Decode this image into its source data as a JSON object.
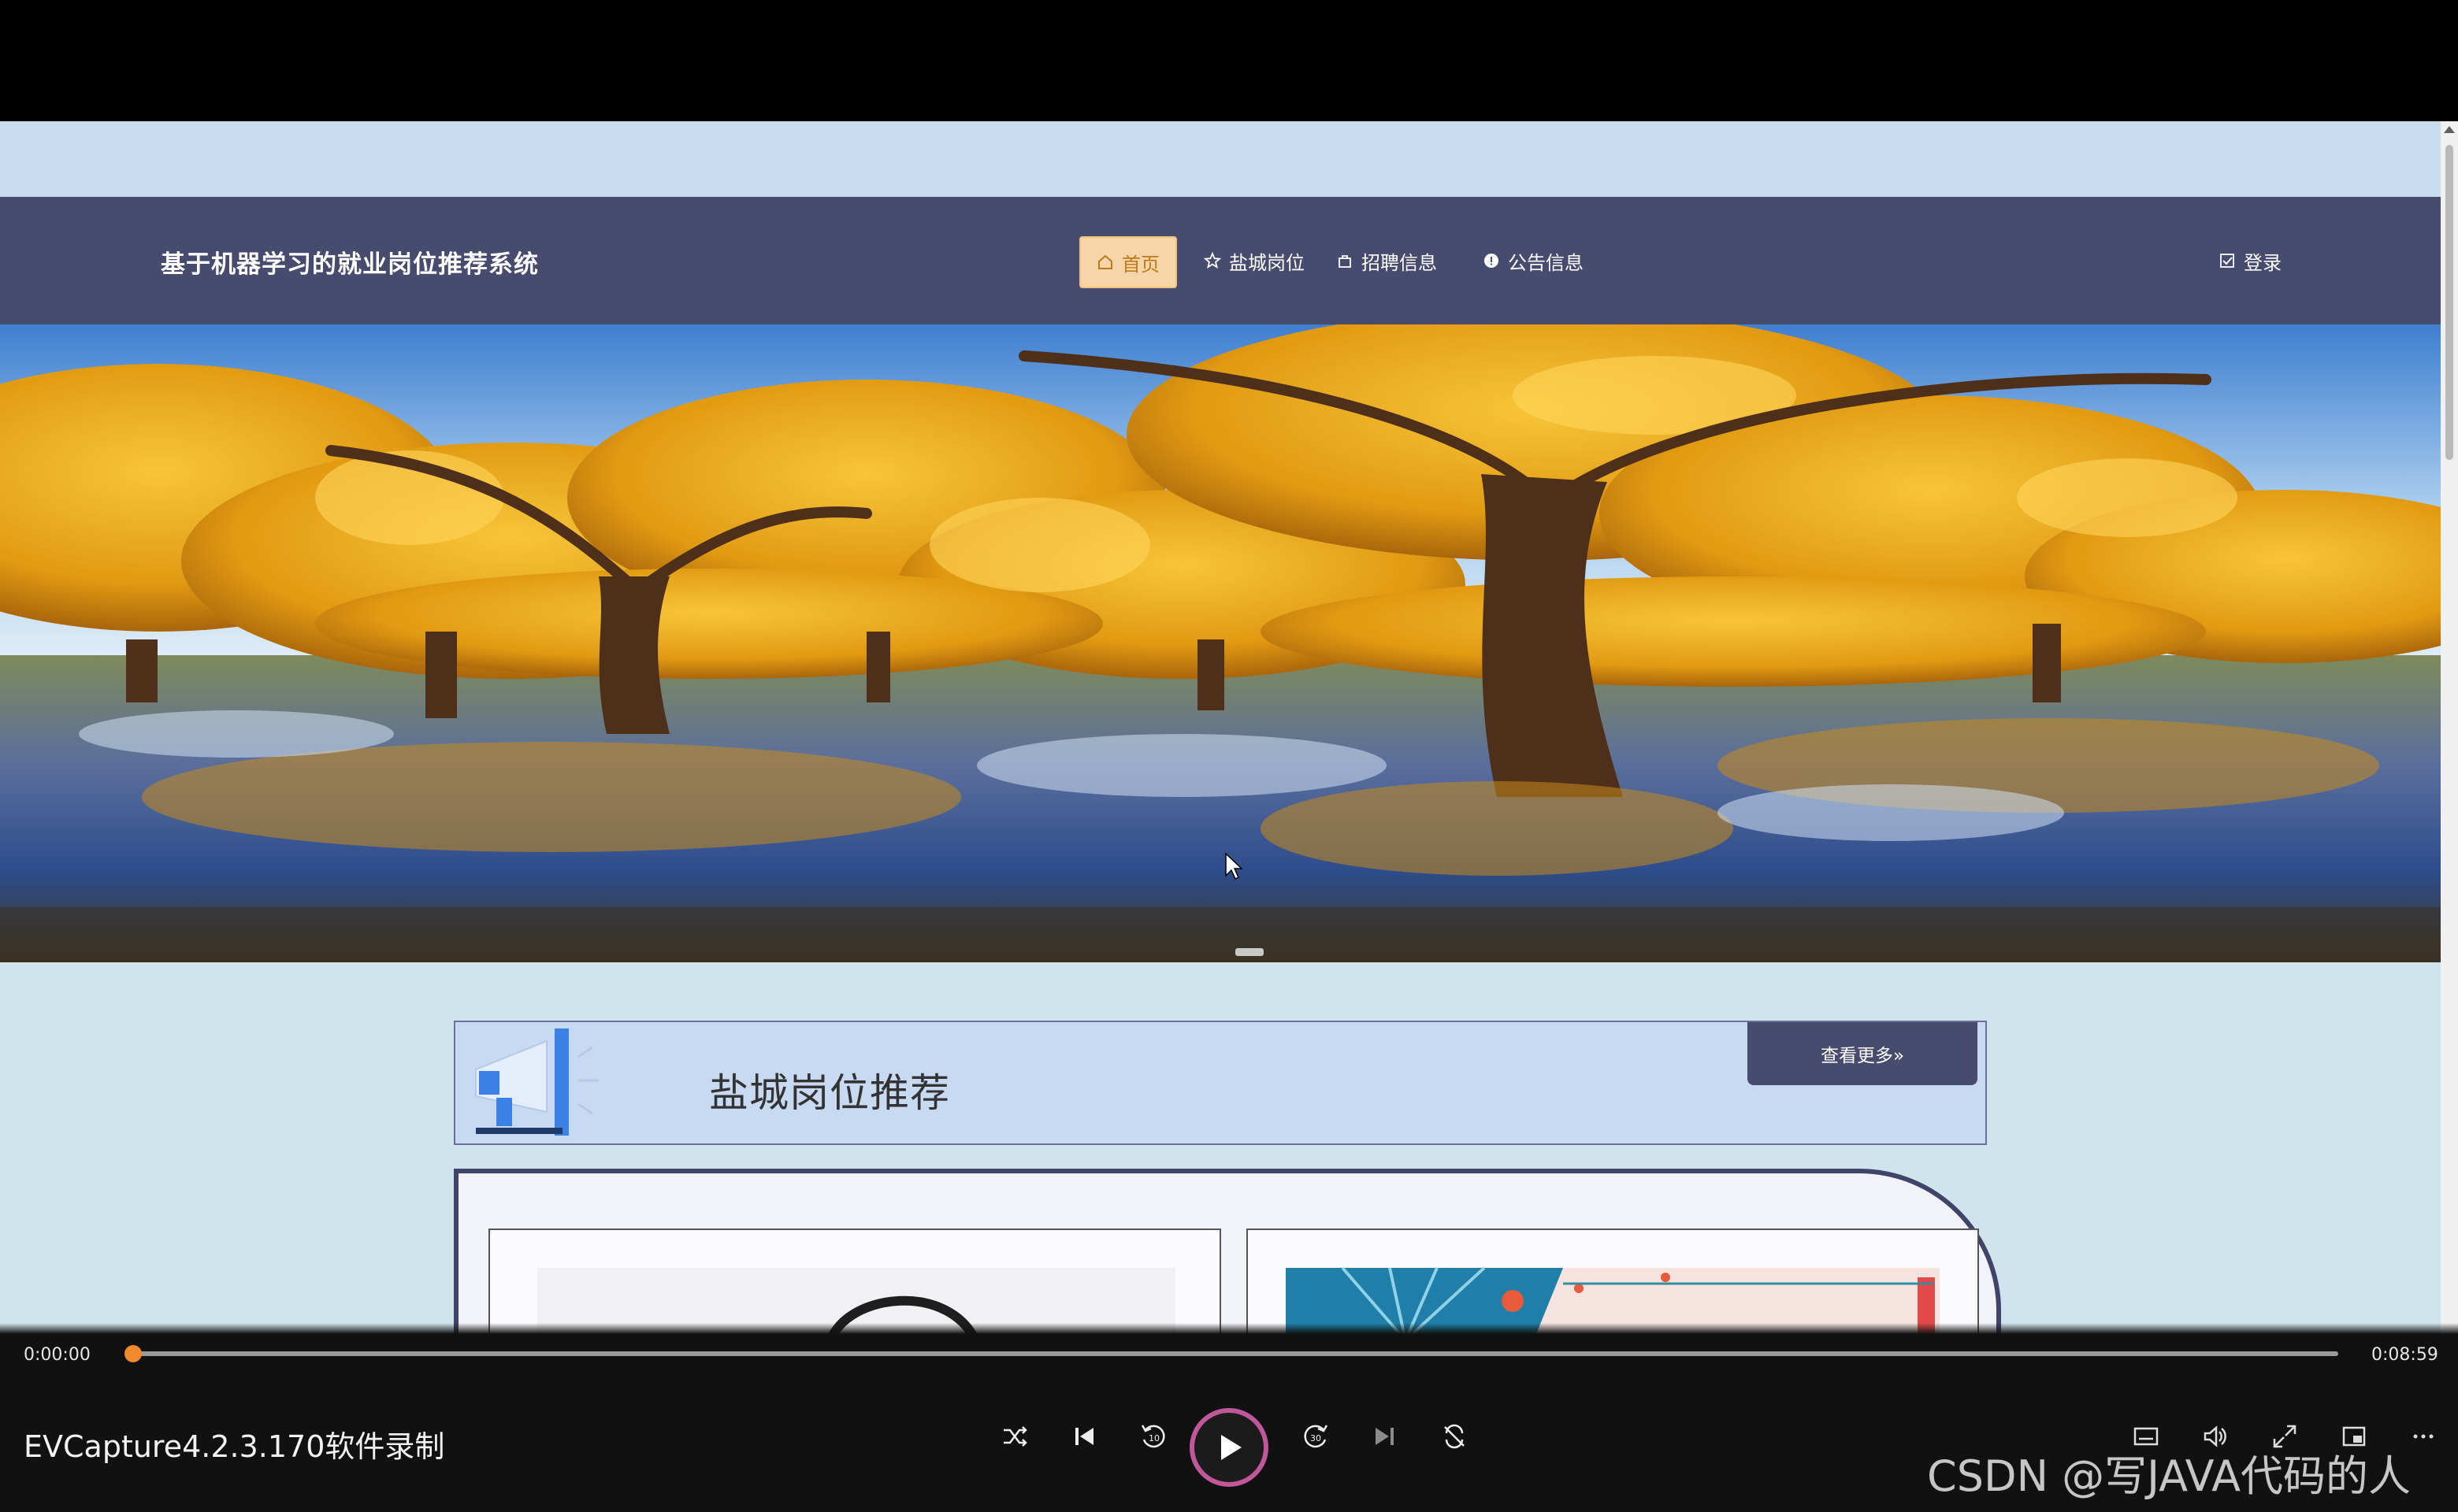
{
  "site": {
    "title": "基于机器学习的就业岗位推荐系统",
    "nav": [
      {
        "label": "首页",
        "icon": "home-icon",
        "active": true
      },
      {
        "label": "盐城岗位",
        "icon": "star-icon",
        "active": false
      },
      {
        "label": "招聘信息",
        "icon": "bag-icon",
        "active": false
      },
      {
        "label": "公告信息",
        "icon": "info-icon",
        "active": false
      }
    ],
    "login_label": "登录"
  },
  "section": {
    "title": "盐城岗位推荐",
    "more_label": "查看更多»"
  },
  "player": {
    "current_time": "0:00:00",
    "total_time": "0:08:59",
    "progress": 0,
    "caption": "EVCapture4.2.3.170软件录制",
    "controls": [
      "shuffle-icon",
      "previous-icon",
      "rewind-10-icon",
      "play-icon",
      "forward-30-icon",
      "next-icon",
      "repeat-off-icon",
      "subtitles-icon",
      "volume-icon",
      "expand-icon",
      "miniplayer-icon",
      "more-icon"
    ]
  },
  "watermark": "CSDN @写JAVA代码的人",
  "colors": {
    "navbar": "#474b6d",
    "active_nav_bg": "#f6d6a8",
    "active_nav_text": "#c07a1e",
    "progress_knob": "#f08a2e",
    "play_ring": "#c0579a"
  }
}
